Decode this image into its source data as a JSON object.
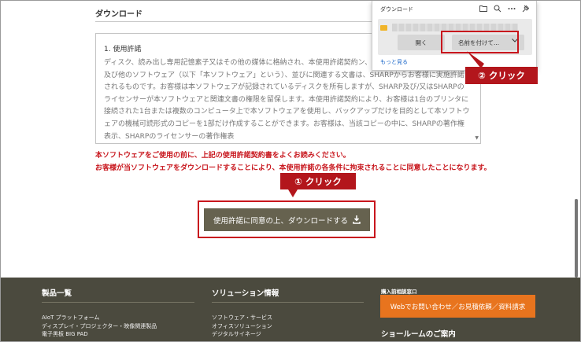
{
  "section": {
    "title": "ダウンロード"
  },
  "license": {
    "heading": "1. 使用許諾",
    "body": "ディスク、読み出し専用記憶素子又はその他の媒体に格納され、本使用許諾契約ン、デモ用プログラム、システム及び他のソフトウェア（以下「本ソフトウェア」という）、並びに関連する文書は、SHARPからお客様に実施許諾されるものです。お客様は本ソフトウェアが記録されているディスクを所有しますが、SHARP及び/又はSHARPのライセンサーが本ソフトウェアと関連文書の権限を留保します。本使用許諾契約により、お客様は1台のプリンタに接続された1台または複数のコンピュータ上で本ソフトウェアを使用し、バックアップだけを目的として本ソフトウェアの機械可読形式のコピーを1部だけ作成することができます。お客様は、当該コピーの中に、SHARPの著作権表示、SHARPのライセンサーの著作権表"
  },
  "notice": {
    "line1": "本ソフトウェアをご使用の前に、上記の使用許諾契約書をよくお読みください。",
    "line2": "お客様が当ソフトウェアをダウンロードすることにより、本使用許諾の各条件に拘束されることに同意したことになります。"
  },
  "download_button": {
    "label": "使用許諾に同意の上、ダウンロードする"
  },
  "callouts": {
    "step1": "① クリック",
    "step2": "② クリック"
  },
  "download_panel": {
    "title": "ダウンロード",
    "open_label": "開く",
    "save_as_label": "名前を付けて...",
    "more_label": "もっと見る",
    "icons": [
      "folder-icon",
      "search-icon",
      "more-icon",
      "pin-icon"
    ]
  },
  "footer": {
    "products": {
      "title": "製品一覧",
      "items": [
        "AIoT プラットフォーム",
        "ディスプレイ・プロジェクター・映像関連製品",
        "電子黒板 BIG PAD"
      ]
    },
    "solutions": {
      "title": "ソリューション情報",
      "items": [
        "ソフトウェア・サービス",
        "オフィスソリューション",
        "デジタルサイネージ"
      ]
    },
    "contact": {
      "label": "購入前相談窓口",
      "web_button": "Webでお問い合わせ／お見積依頼／資料請求",
      "showroom": "ショールームのご案内"
    }
  },
  "colors": {
    "accent_red": "#c8161d",
    "button_olive": "#66624f",
    "footer_bg": "#4b4a3e",
    "footer_orange": "#e8741e"
  }
}
